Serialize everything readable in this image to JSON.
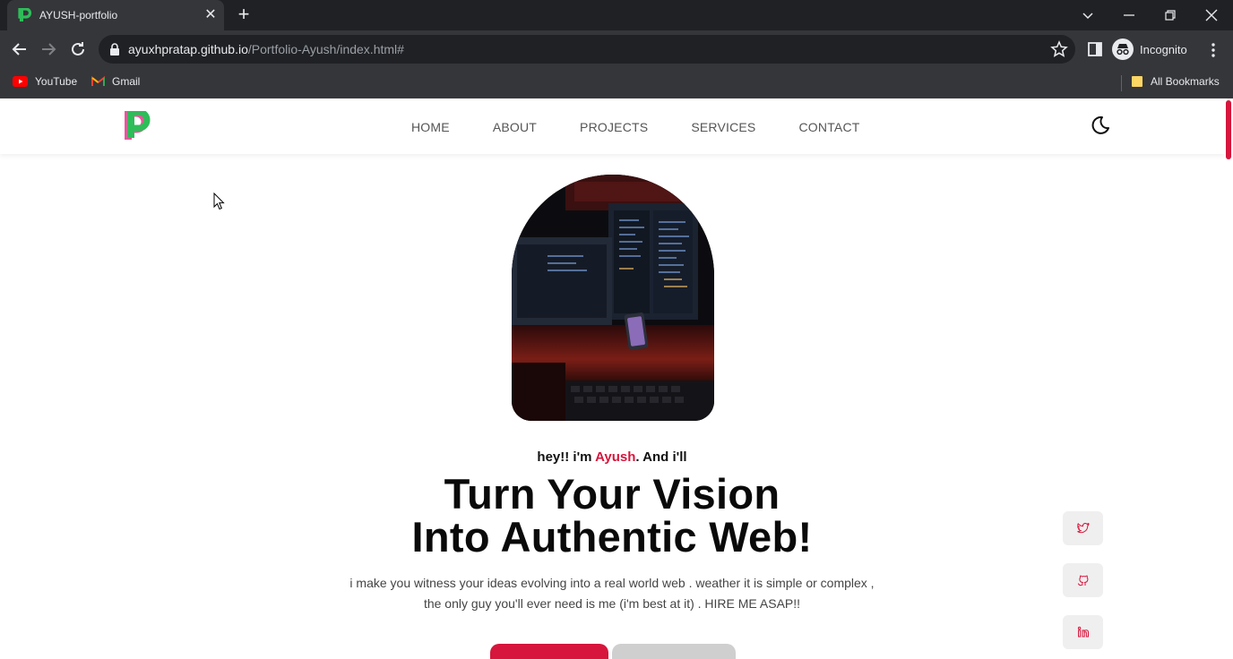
{
  "browser": {
    "tab": {
      "title": "AYUSH-portfolio"
    },
    "url": {
      "host": "ayuxhpratap.github.io",
      "path": "/Portfolio-Ayush/index.html#"
    },
    "profile_label": "Incognito",
    "bookmarks": [
      {
        "label": "YouTube",
        "icon": "youtube-icon"
      },
      {
        "label": "Gmail",
        "icon": "gmail-icon"
      }
    ],
    "all_bookmarks_label": "All Bookmarks"
  },
  "site": {
    "nav": [
      "HOME",
      "ABOUT",
      "PROJECTS",
      "SERVICES",
      "CONTACT"
    ],
    "hero": {
      "greeting_prefix": "hey!! i'm ",
      "greeting_name": "Ayush",
      "greeting_suffix": ". And i'll",
      "headline_line1": "Turn Your Vision",
      "headline_line2": "Into Authentic Web!",
      "desc_line1": "i make you witness your ideas evolving into a real world web . weather it is simple or complex ,",
      "desc_line2": "the only guy you'll ever need is me (i'm best at it) . HIRE ME ASAP!!"
    },
    "social_icons": [
      "twitter-icon",
      "github-icon",
      "linkedin-icon"
    ]
  },
  "colors": {
    "accent": "#d6163c",
    "browser_dark": "#202124",
    "browser_toolbar": "#35363a"
  }
}
